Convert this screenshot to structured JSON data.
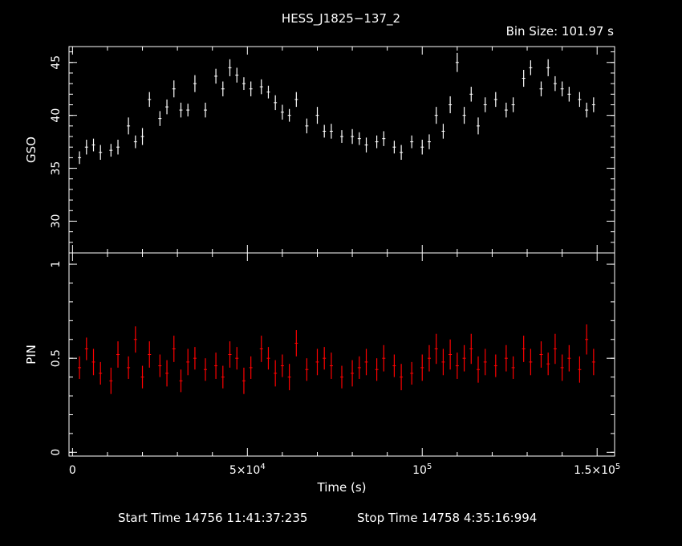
{
  "title": "HESS_J1825−137_2",
  "bin_size_label": "Bin Size: 101.97 s",
  "start_time_label": "Start Time 14756 11:41:37:235",
  "stop_time_label": "Stop Time 14758  4:35:16:994",
  "colors": {
    "background": "#000000",
    "axes": "#ffffff",
    "gso_series": "#ffffff",
    "pin_series": "#ff0000"
  },
  "chart_data": [
    {
      "type": "line",
      "series": [
        {
          "name": "",
          "x": [
            2000,
            4000,
            6000,
            8000,
            11000,
            13000,
            16000,
            18000,
            20000,
            22000,
            25000,
            27000,
            29000,
            31000,
            33000,
            35000,
            38000,
            41000,
            43000,
            45000,
            47000,
            49000,
            51000,
            54000,
            56000,
            58000,
            60000,
            62000,
            64000,
            67000,
            70000,
            72000,
            74000,
            77000,
            80000,
            82000,
            84000,
            87000,
            89000,
            92000,
            94000,
            97000,
            100000,
            102000,
            104000,
            106000,
            108000,
            110000,
            112000,
            114000,
            116000,
            118000,
            121000,
            124000,
            126000,
            129000,
            131000,
            134000,
            136000,
            138000,
            140000,
            142000,
            145000,
            147000,
            149000
          ],
          "y": [
            36.0,
            37.0,
            37.2,
            36.5,
            36.7,
            37.0,
            39.0,
            37.5,
            38.0,
            41.5,
            39.7,
            40.8,
            42.5,
            40.5,
            40.5,
            43.0,
            40.5,
            43.7,
            42.5,
            44.5,
            43.8,
            43.0,
            42.5,
            42.7,
            42.2,
            41.2,
            40.3,
            40.0,
            41.5,
            39.0,
            40.0,
            38.5,
            38.5,
            38.0,
            38.0,
            37.8,
            37.2,
            37.5,
            37.8,
            37.0,
            36.5,
            37.5,
            37.0,
            37.5,
            40.0,
            38.5,
            41.0,
            45.0,
            40.0,
            42.0,
            39.0,
            41.0,
            41.5,
            40.5,
            41.0,
            43.5,
            44.5,
            42.5,
            44.5,
            43.0,
            42.5,
            42.0,
            41.5,
            40.5,
            41.0
          ],
          "err": [
            0.6,
            0.7,
            0.6,
            0.7,
            0.6,
            0.7,
            0.8,
            0.6,
            0.8,
            0.7,
            0.7,
            0.7,
            0.8,
            0.7,
            0.6,
            0.8,
            0.7,
            0.7,
            0.7,
            0.8,
            0.7,
            0.6,
            0.7,
            0.7,
            0.6,
            0.7,
            0.7,
            0.6,
            0.7,
            0.7,
            0.8,
            0.6,
            0.7,
            0.6,
            0.7,
            0.6,
            0.7,
            0.6,
            0.7,
            0.6,
            0.7,
            0.6,
            0.7,
            0.7,
            0.8,
            0.7,
            0.8,
            0.9,
            0.8,
            0.7,
            0.8,
            0.7,
            0.7,
            0.7,
            0.7,
            0.8,
            0.7,
            0.7,
            0.8,
            0.7,
            0.7,
            0.7,
            0.7,
            0.7,
            0.7
          ]
        }
      ],
      "xlabel": "",
      "ylabel": "GSO",
      "xlim": [
        -1000,
        155000
      ],
      "ylim": [
        27,
        46.5
      ],
      "yticks": [
        30,
        35,
        40,
        45
      ],
      "grid": false
    },
    {
      "type": "line",
      "series": [
        {
          "name": "",
          "x": [
            2000,
            4000,
            6000,
            8000,
            11000,
            13000,
            16000,
            18000,
            20000,
            22000,
            25000,
            27000,
            29000,
            31000,
            33000,
            35000,
            38000,
            41000,
            43000,
            45000,
            47000,
            49000,
            51000,
            54000,
            56000,
            58000,
            60000,
            62000,
            64000,
            67000,
            70000,
            72000,
            74000,
            77000,
            80000,
            82000,
            84000,
            87000,
            89000,
            92000,
            94000,
            97000,
            100000,
            102000,
            104000,
            106000,
            108000,
            110000,
            112000,
            114000,
            116000,
            118000,
            121000,
            124000,
            126000,
            129000,
            131000,
            134000,
            136000,
            138000,
            140000,
            142000,
            145000,
            147000,
            149000
          ],
          "y": [
            0.45,
            0.55,
            0.48,
            0.42,
            0.38,
            0.52,
            0.45,
            0.6,
            0.4,
            0.52,
            0.46,
            0.42,
            0.55,
            0.38,
            0.48,
            0.5,
            0.44,
            0.46,
            0.4,
            0.52,
            0.5,
            0.38,
            0.45,
            0.55,
            0.5,
            0.42,
            0.46,
            0.4,
            0.58,
            0.44,
            0.48,
            0.5,
            0.46,
            0.4,
            0.42,
            0.45,
            0.48,
            0.44,
            0.5,
            0.46,
            0.4,
            0.42,
            0.45,
            0.5,
            0.55,
            0.48,
            0.52,
            0.46,
            0.5,
            0.55,
            0.44,
            0.48,
            0.46,
            0.5,
            0.45,
            0.55,
            0.48,
            0.52,
            0.47,
            0.55,
            0.45,
            0.5,
            0.44,
            0.6,
            0.48
          ],
          "err": [
            0.06,
            0.06,
            0.07,
            0.06,
            0.07,
            0.07,
            0.06,
            0.07,
            0.06,
            0.07,
            0.06,
            0.07,
            0.07,
            0.06,
            0.07,
            0.06,
            0.06,
            0.07,
            0.06,
            0.07,
            0.06,
            0.07,
            0.06,
            0.07,
            0.06,
            0.07,
            0.06,
            0.07,
            0.07,
            0.06,
            0.07,
            0.06,
            0.07,
            0.06,
            0.07,
            0.06,
            0.07,
            0.06,
            0.07,
            0.06,
            0.07,
            0.06,
            0.07,
            0.07,
            0.08,
            0.07,
            0.08,
            0.07,
            0.07,
            0.08,
            0.07,
            0.07,
            0.06,
            0.07,
            0.06,
            0.07,
            0.07,
            0.07,
            0.06,
            0.08,
            0.07,
            0.07,
            0.07,
            0.08,
            0.07
          ]
        }
      ],
      "xlabel": "Time (s)",
      "ylabel": "PIN",
      "xlim": [
        -1000,
        155000
      ],
      "ylim": [
        -0.02,
        1.06
      ],
      "yticks": [
        0,
        0.5,
        1
      ],
      "ytick_labels": [
        "0",
        "0.5",
        "1"
      ],
      "xticks": [
        0,
        50000,
        100000,
        150000
      ],
      "xtick_labels": [
        {
          "base": "0",
          "exp": ""
        },
        {
          "base": "5×10",
          "exp": "4"
        },
        {
          "base": "10",
          "exp": "5"
        },
        {
          "base": "1.5×10",
          "exp": "5"
        }
      ],
      "grid": false
    }
  ]
}
